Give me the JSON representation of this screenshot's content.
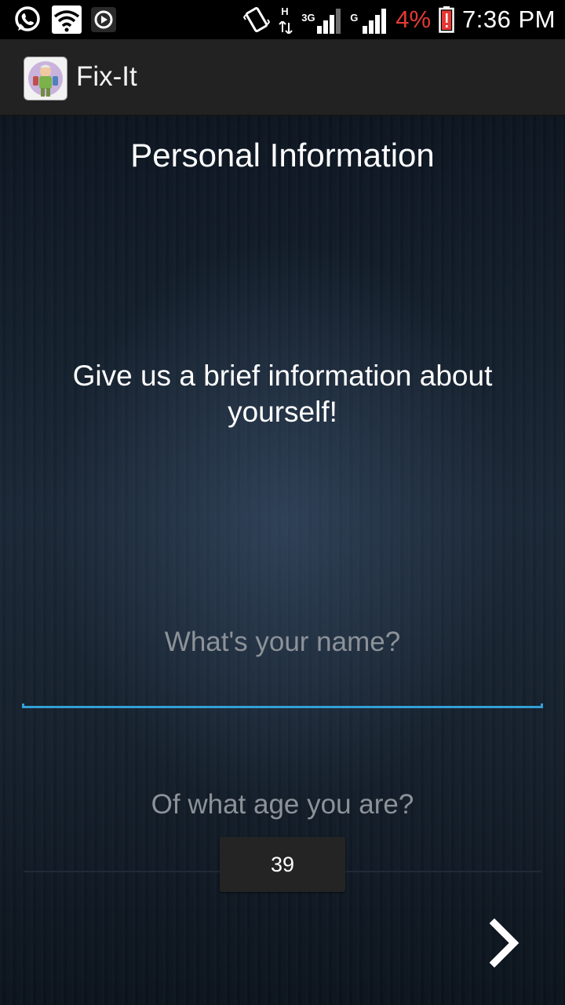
{
  "status_bar": {
    "icons_left": [
      "whatsapp-icon",
      "wifi-icon",
      "media-icon"
    ],
    "icons_right": [
      "vibrate-icon",
      "hspa-data-icon",
      "signal-3g-icon",
      "signal-g-icon",
      "battery-alert-icon"
    ],
    "net_label_h": "H",
    "net_label_3g": "3G",
    "net_label_g": "G",
    "battery_percent": "4%",
    "time": "7:36 PM",
    "colors": {
      "battery_low": "#e53935"
    }
  },
  "action_bar": {
    "app_icon": "fix-it-handyman-logo",
    "title": "Fix-It"
  },
  "main": {
    "page_title": "Personal Information",
    "intro": "Give us a brief information about yourself!",
    "name_field": {
      "placeholder": "What's your name?",
      "value": ""
    },
    "age_label": "Of what age you are?",
    "age_value": "39",
    "next_icon": "chevron-right-icon"
  },
  "colors": {
    "accent": "#33a0d6",
    "hint_text": "#8d9299",
    "action_bar_bg": "#222222"
  }
}
